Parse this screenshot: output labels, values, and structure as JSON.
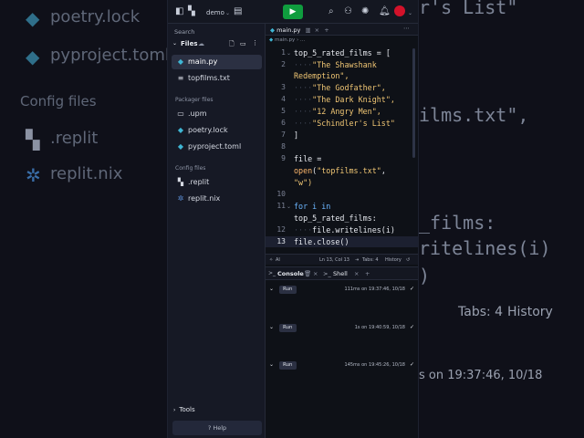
{
  "background": {
    "left_items": [
      "poetry.lock",
      "pyproject.toml",
      "Config files",
      ".replit",
      "replit.nix"
    ],
    "right_items": [
      "r's List\"",
      "ilms.txt\",",
      "_films:",
      "ritelines(i)",
      ")",
      "Tabs: 4",
      "History",
      "s on 19:37:46, 10/18"
    ]
  },
  "topbar": {
    "repl_name": "demo",
    "run_icon": "play-icon",
    "accent": "#0f9d3e"
  },
  "sidebar": {
    "search_placeholder": "Search",
    "files_label": "Files",
    "items": [
      {
        "label": "main.py",
        "icon": "python-icon",
        "active": true
      },
      {
        "label": "topfilms.txt",
        "icon": "text-file-icon",
        "active": false
      }
    ],
    "packager_label": "Packager files",
    "packager_items": [
      {
        "label": ".upm",
        "icon": "folder-icon"
      },
      {
        "label": "poetry.lock",
        "icon": "python-icon"
      },
      {
        "label": "pyproject.toml",
        "icon": "python-icon"
      }
    ],
    "config_label": "Config files",
    "config_items": [
      {
        "label": ".replit",
        "icon": "replit-icon"
      },
      {
        "label": "replit.nix",
        "icon": "nix-icon"
      }
    ],
    "tools_label": "Tools",
    "help_label": "Help"
  },
  "editor": {
    "tab_label": "main.py",
    "breadcrumb": "main.py",
    "line_numbers": [
      "1",
      "2",
      "3",
      "4",
      "5",
      "6",
      "7",
      "8",
      "9",
      "10",
      "11",
      "12",
      "13"
    ],
    "lines": [
      "top_5_rated_films = [",
      "\"The Shawshank",
      "Redemption\",",
      "\"The Godfather\",",
      "\"The Dark Knight\",",
      "\"12 Angry Men\",",
      "\"Schindler's List\"",
      "]",
      "file =",
      "open(\"topfilms.txt\",",
      "\"w\")",
      "for i in",
      "top_5_rated_films:",
      "file.writelines(i)",
      "file.close()"
    ],
    "status_left": "AI",
    "status_pos": "Ln 13, Col 13",
    "status_tabs": "Tabs: 4",
    "status_history": "History"
  },
  "console": {
    "tab_console": "Console",
    "tab_shell": "Shell",
    "runs": [
      {
        "label": "Run",
        "meta": "111ms on 19:37:46, 10/18"
      },
      {
        "label": "Run",
        "meta": "1s on 19:40:59, 10/18"
      },
      {
        "label": "Run",
        "meta": "145ms on 19:45:26, 10/18"
      }
    ]
  }
}
